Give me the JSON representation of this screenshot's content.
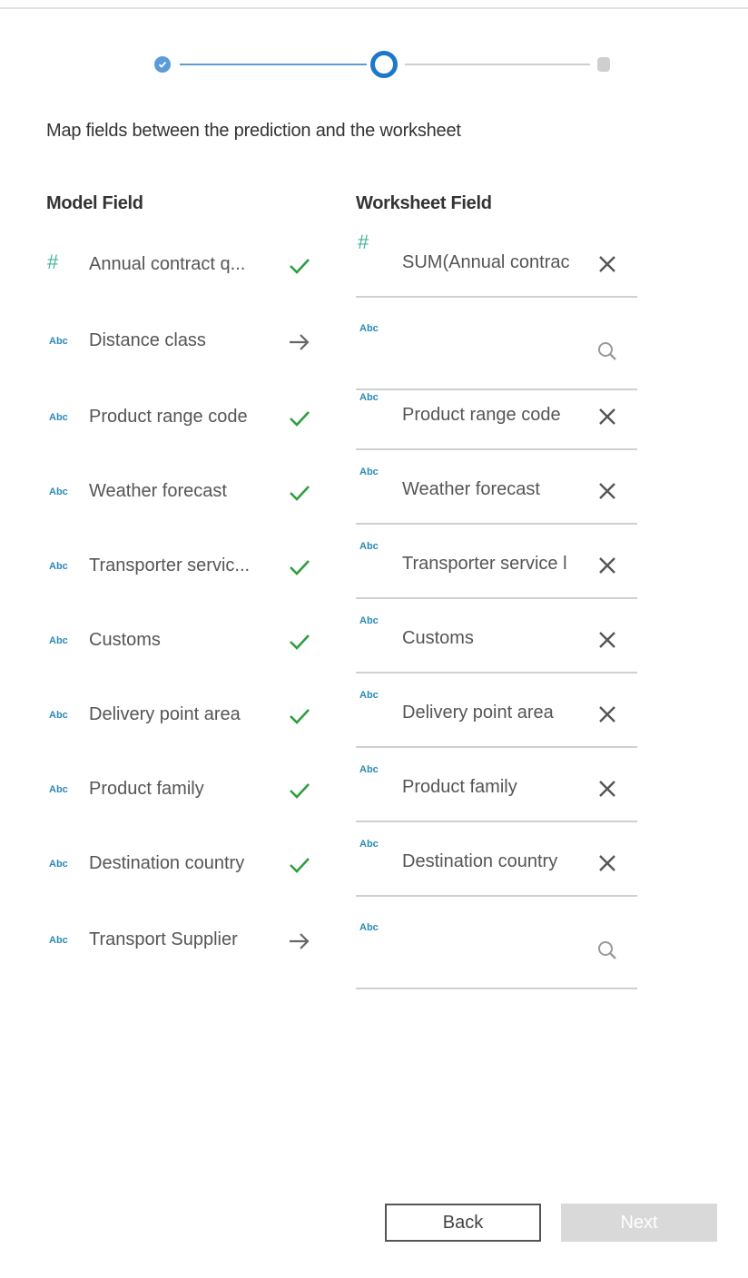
{
  "stepper": {
    "steps": [
      "done",
      "current",
      "pending"
    ]
  },
  "title": "Map fields between the prediction and the worksheet",
  "headers": {
    "model": "Model Field",
    "worksheet": "Worksheet Field"
  },
  "type_labels": {
    "string": "Abc",
    "number": "#"
  },
  "rows": [
    {
      "model": "Annual contract q...",
      "type": "number",
      "status": "mapped",
      "worksheet": "SUM(Annual contrac",
      "action": "clear"
    },
    {
      "model": "Distance class",
      "type": "string",
      "status": "unmapped",
      "worksheet": "",
      "action": "search"
    },
    {
      "model": "Product range code",
      "type": "string",
      "status": "mapped",
      "worksheet": "Product range code",
      "action": "clear"
    },
    {
      "model": "Weather forecast",
      "type": "string",
      "status": "mapped",
      "worksheet": "Weather forecast",
      "action": "clear"
    },
    {
      "model": "Transporter servic...",
      "type": "string",
      "status": "mapped",
      "worksheet": "Transporter service l",
      "action": "clear"
    },
    {
      "model": "Customs",
      "type": "string",
      "status": "mapped",
      "worksheet": "Customs",
      "action": "clear"
    },
    {
      "model": "Delivery point area",
      "type": "string",
      "status": "mapped",
      "worksheet": "Delivery point area",
      "action": "clear"
    },
    {
      "model": "Product family",
      "type": "string",
      "status": "mapped",
      "worksheet": "Product family",
      "action": "clear"
    },
    {
      "model": "Destination country",
      "type": "string",
      "status": "mapped",
      "worksheet": "Destination country",
      "action": "clear"
    },
    {
      "model": "Transport Supplier",
      "type": "string",
      "status": "unmapped",
      "worksheet": "",
      "action": "search"
    }
  ],
  "buttons": {
    "back": "Back",
    "next": "Next"
  },
  "colors": {
    "accent": "#1f77c8",
    "check": "#2e9e3e",
    "type_string": "#2a8bb5",
    "type_number": "#3fb39c"
  }
}
